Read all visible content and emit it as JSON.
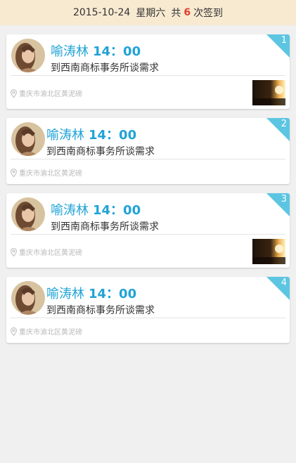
{
  "header": {
    "date": "2015-10-24",
    "weekday": "星期六",
    "count_prefix": "共",
    "count": "6",
    "count_suffix": "次签到"
  },
  "entries": [
    {
      "index": "1",
      "name": "喻涛林",
      "time": "14：00",
      "desc": "到西南商标事务所谈需求",
      "location": "重庆市渝北区黄泥磅",
      "has_photo": true
    },
    {
      "index": "2",
      "name": "喻涛林",
      "time": "14：00",
      "desc": "到西南商标事务所谈需求",
      "location": "重庆市渝北区黄泥磅",
      "has_photo": false
    },
    {
      "index": "3",
      "name": "喻涛林",
      "time": "14：00",
      "desc": "到西南商标事务所谈需求",
      "location": "重庆市渝北区黄泥磅",
      "has_photo": true
    },
    {
      "index": "4",
      "name": "喻涛林",
      "time": "14：00",
      "desc": "到西南商标事务所谈需求",
      "location": "重庆市渝北区黄泥磅",
      "has_photo": false
    }
  ],
  "colors": {
    "accent": "#1fa3d6",
    "ribbon": "#5cc6e2",
    "count": "#e23c2a",
    "header_bg": "#f8ead1"
  },
  "icons": {
    "location": "map-pin-icon"
  }
}
